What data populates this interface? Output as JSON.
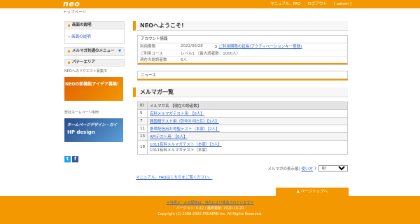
{
  "header": {
    "logo": "neo",
    "links": [
      "マニュアル、FAQ",
      "ログアウト",
      "[ admin ]"
    ],
    "breadcrumb": "トップページ"
  },
  "sidebar": {
    "section1_title": "画面の説明",
    "section1_item": "画面の説明",
    "section2_title": "メルマガ共通のメニュー",
    "section3_title": "バナーエリア",
    "banner1_caption": "NEOへのリクエスト募集中",
    "banner1_text": "NEOの新機能アイデア募集！",
    "banner2_caption": "弊社ホームページ制作",
    "banner2_text": "ホームページデザイン・ガイ",
    "banner2_title": "HP design",
    "social": [
      "t",
      "f"
    ]
  },
  "main": {
    "welcome_title": "NEOへようこそ!",
    "account": {
      "heading": "アカウント情報",
      "rows": [
        {
          "label": "利用期限",
          "value": "2022/06/28",
          "action": "ご利用期限の延長(アクティベーションキー登録)"
        },
        {
          "label": "ご利用コース",
          "value": "レベル1 （最大読者数：1000人）",
          "action": ""
        },
        {
          "label": "現在の総読者数",
          "value": "6人",
          "action": ""
        }
      ]
    },
    "news_heading": "ニュース",
    "list_title": "メルマガ一覧",
    "table": {
      "headers": [
        "ID",
        "メルマガ名 【現在の読者数】"
      ],
      "rows": [
        {
          "id": "5",
          "name": "有料メルマガテスト用　【0人】",
          "sub": ""
        },
        {
          "id": "7",
          "name": "韓国語テスト用（한국어 테스트）【1人】",
          "sub": ""
        },
        {
          "id": "11",
          "name": "携帯配信用お得聖テスト（本家）【2人】",
          "sub": ""
        },
        {
          "id": "13",
          "name": "APIテスト用　【0人】",
          "sub": ""
        },
        {
          "id": "18",
          "name": "1011有料メルマガテスト（本家）【3人】",
          "sub": "1011有料メルマガテスト（本家）"
        }
      ]
    },
    "per_page_label": "メルマガの表示順(",
    "per_page_link": "使い方",
    "per_page_suffix": "):",
    "per_page_value": "ID",
    "manual_link": "マニュアル、FAQはこちらをご覧ください。"
  },
  "footer": {
    "page_top": "▲ ページトップへ",
    "notice": "＊当規メールの配信は、当社により検出されています＊",
    "version": "バージョン: 6.42 / 最終更新: 2020-10-20",
    "copyright": "Copyright (C) 2008-2020 FRUAFAN Inc. All Rights Reserved."
  },
  "colors": {
    "accent": "#f39800",
    "link": "#3366cc"
  }
}
